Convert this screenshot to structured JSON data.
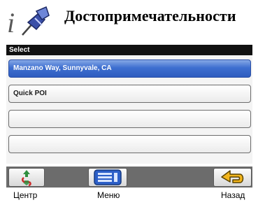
{
  "header": {
    "title": "Достопримечательности",
    "icon": "info-pin-icon"
  },
  "screen": {
    "title": "Select",
    "items": [
      {
        "label": "Manzano Way, Sunnyvale, CA",
        "selected": true
      },
      {
        "label": "Quick POI",
        "selected": false
      },
      {
        "label": "",
        "selected": false
      },
      {
        "label": "",
        "selected": false
      }
    ]
  },
  "toolbar": {
    "center_label": "Центр",
    "menu_label": "Меню",
    "back_label": "Назад"
  },
  "colors": {
    "selected_item": "#3e6fd0",
    "screen_header": "#111111",
    "toolbar": "#6c6c6c"
  }
}
